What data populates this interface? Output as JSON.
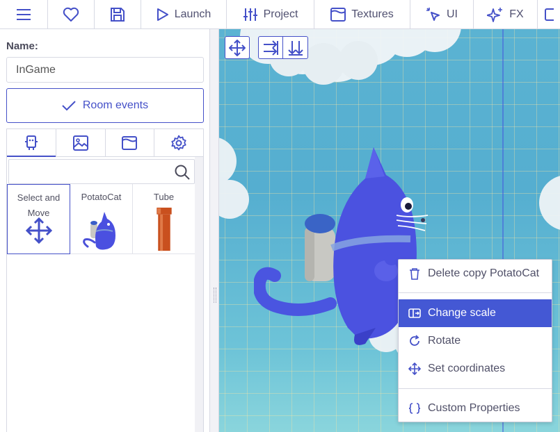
{
  "toolbar": {
    "launch": "Launch",
    "project": "Project",
    "textures": "Textures",
    "ui": "UI",
    "fx": "FX"
  },
  "properties": {
    "name_label": "Name:",
    "name_value": "InGame",
    "room_events": "Room events"
  },
  "tabs": [
    "copies-icon",
    "image-icon",
    "background-icon",
    "settings-icon"
  ],
  "templates": [
    {
      "label": "Select and Move"
    },
    {
      "label": "PotatoCat"
    },
    {
      "label": "Tube"
    }
  ],
  "context_menu": {
    "delete": "Delete copy PotatoCat",
    "change_scale": "Change scale",
    "rotate": "Rotate",
    "set_coordinates": "Set coordinates",
    "custom_properties": "Custom Properties"
  },
  "colors": {
    "accent": "#4450c8",
    "highlight": "#4458d4",
    "sky": "#5bb3d2"
  }
}
